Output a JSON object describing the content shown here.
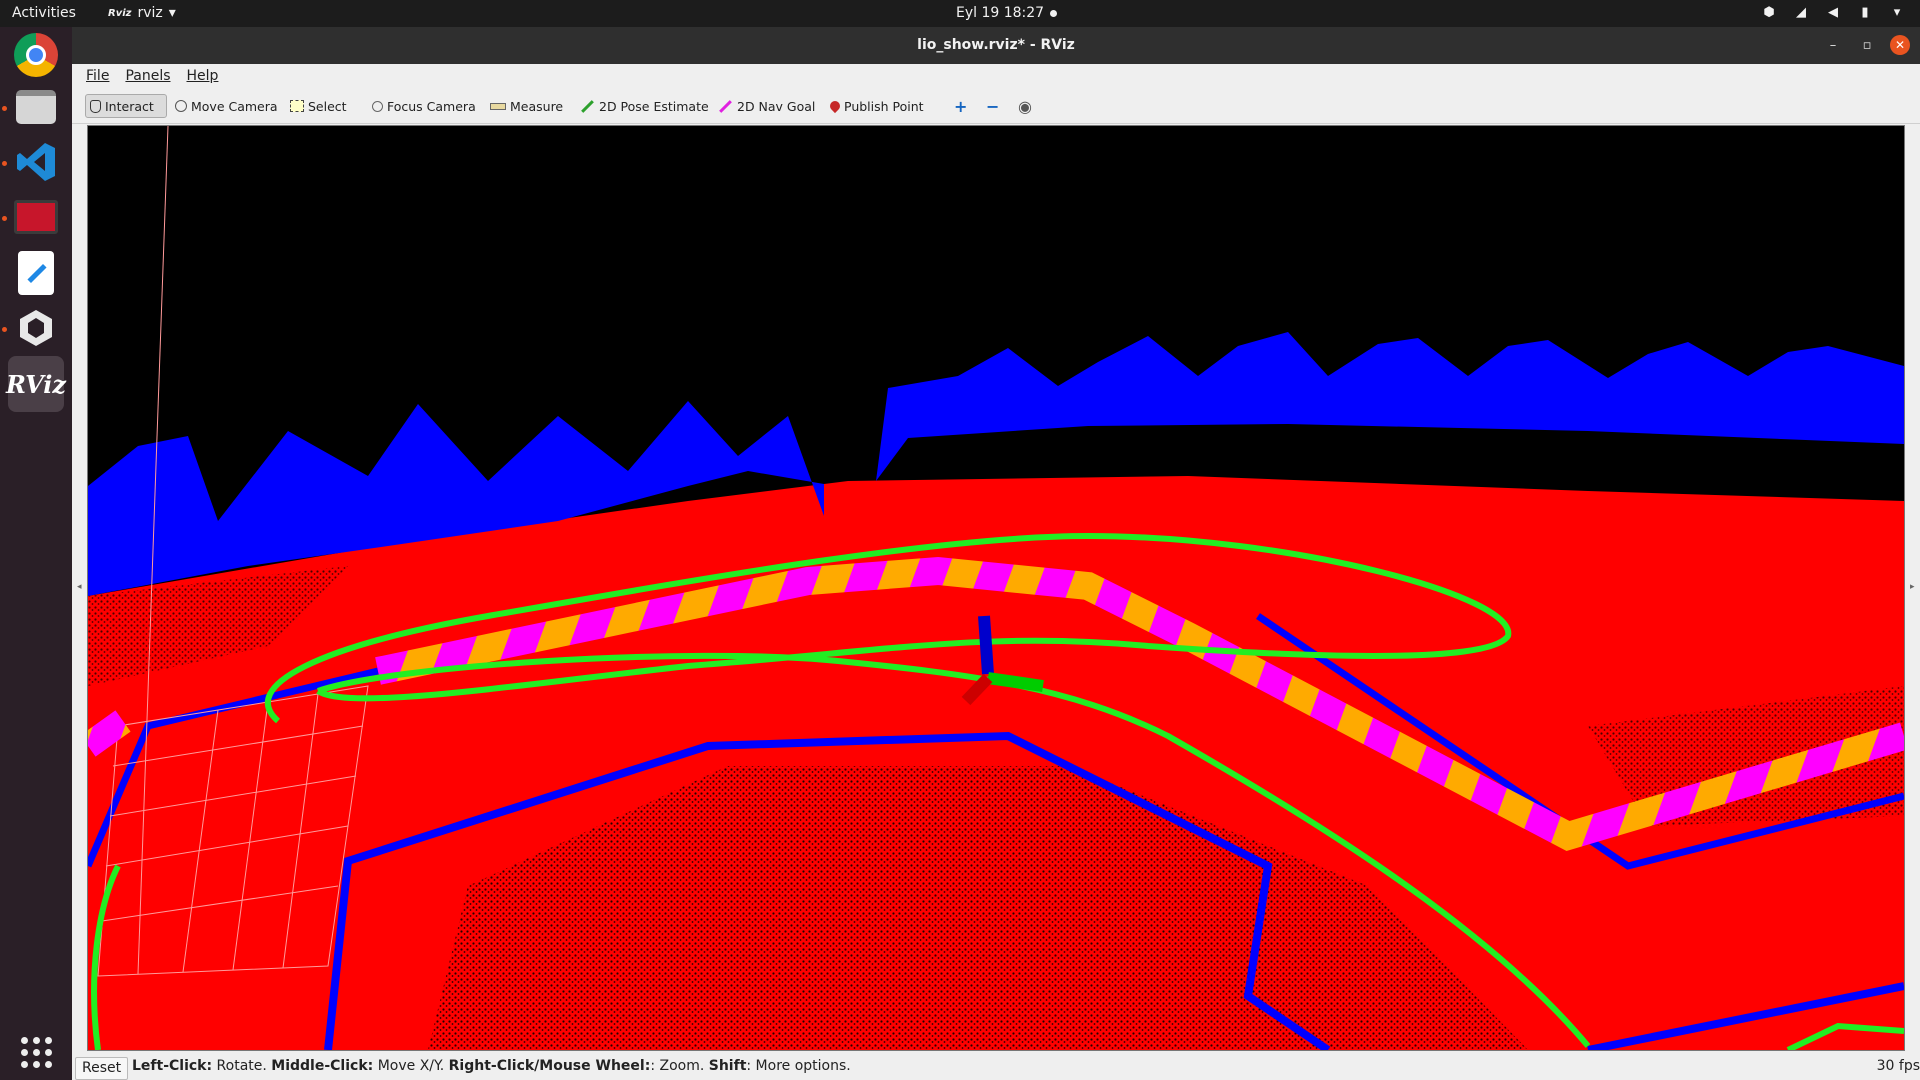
{
  "topbar": {
    "activities": "Activities",
    "app_name": "rviz",
    "app_logo_text": "Rviz",
    "clock": "Eyl 19  18:27"
  },
  "dock": {
    "items": [
      "google-chrome",
      "files",
      "visual-studio-code",
      "terminal",
      "text-editor",
      "unity-hub",
      "rviz",
      "show-applications"
    ],
    "active": "rviz",
    "rviz_label": "RViz"
  },
  "window": {
    "title": "lio_show.rviz* - RViz",
    "controls": [
      "–",
      "▫",
      "✕"
    ]
  },
  "menubar": {
    "file": "File",
    "panels": "Panels",
    "help": "Help"
  },
  "toolbar": {
    "interact": "Interact",
    "move_camera": "Move Camera",
    "select": "Select",
    "focus_camera": "Focus Camera",
    "measure": "Measure",
    "pose_estimate": "2D Pose Estimate",
    "nav_goal": "2D Nav Goal",
    "publish_point": "Publish Point",
    "add_symbol": "+",
    "remove_symbol": "−",
    "view_symbol": "◉",
    "active_tool": "interact"
  },
  "viewport": {
    "background": "#000000",
    "colors": {
      "ground": "#ff0000",
      "walls": "#0000ff",
      "trajectory": "#22ee22",
      "barrier_a": "#ffaa00",
      "barrier_b": "#ff00ff",
      "grid": "#ff9a9a",
      "axis_x": "#cc0000",
      "axis_y": "#00cc00",
      "axis_z": "#0000cc"
    }
  },
  "status": {
    "reset": "Reset",
    "left_click": "Left-Click:",
    "left_action": " Rotate. ",
    "middle_click": "Middle-Click:",
    "middle_action": " Move X/Y. ",
    "right_click": "Right-Click/Mouse Wheel:",
    "right_action": ": Zoom. ",
    "shift": "Shift",
    "shift_action": ": More options.",
    "fps": "30 fps"
  }
}
